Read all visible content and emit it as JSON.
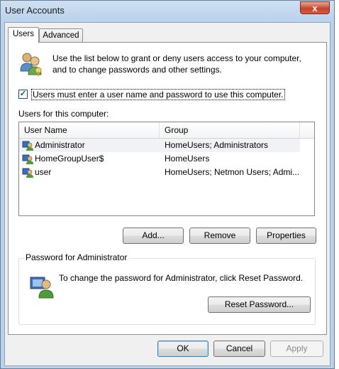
{
  "window": {
    "title": "User Accounts",
    "close_glyph": "x"
  },
  "tabs": [
    {
      "label": "Users",
      "selected": true
    },
    {
      "label": "Advanced",
      "selected": false
    }
  ],
  "intro_text": "Use the list below to grant or deny users access to your computer, and to change passwords and other settings.",
  "require_login": {
    "label": "Users must enter a user name and password to use this computer.",
    "checked": true,
    "check_glyph": "✓"
  },
  "users_section_label": "Users for this computer:",
  "users_table": {
    "columns": [
      "User Name",
      "Group"
    ],
    "rows": [
      {
        "name": "Administrator",
        "group": "HomeUsers; Administrators"
      },
      {
        "name": "HomeGroupUser$",
        "group": "HomeUsers"
      },
      {
        "name": "user",
        "group": "HomeUsers; Netmon Users; Admi..."
      }
    ]
  },
  "user_buttons": {
    "add": "Add...",
    "remove": "Remove",
    "properties": "Properties"
  },
  "password_group": {
    "title": "Password for Administrator",
    "text": "To change the password for Administrator, click Reset Password.",
    "reset_button": "Reset Password..."
  },
  "dialog_buttons": {
    "ok": "OK",
    "cancel": "Cancel",
    "apply": "Apply"
  },
  "icons": {
    "users": "users-icon",
    "user_row": "user-icon",
    "admin": "admin-user-icon"
  }
}
